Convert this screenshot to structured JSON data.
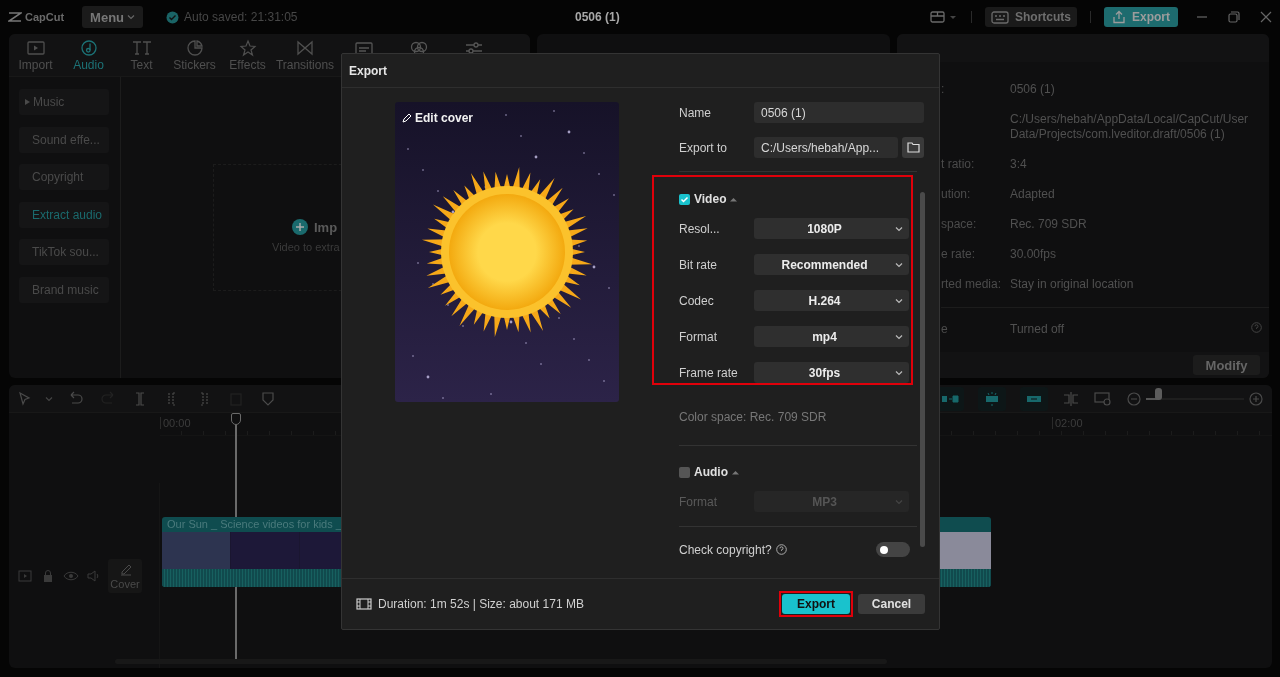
{
  "topbar": {
    "logo": "CapCut",
    "menu": "Menu",
    "autosave": "Auto saved: 21:31:05",
    "project_title": "0506 (1)",
    "shortcuts": "Shortcuts",
    "export": "Export"
  },
  "media_tabs": [
    {
      "label": "Import",
      "selected": false
    },
    {
      "label": "Audio",
      "selected": true
    },
    {
      "label": "Text",
      "selected": false
    },
    {
      "label": "Stickers",
      "selected": false
    },
    {
      "label": "Effects",
      "selected": false
    },
    {
      "label": "Transitions",
      "selected": false
    }
  ],
  "sidebar": {
    "items": [
      {
        "label": "Music",
        "kind": "group",
        "selected": false
      },
      {
        "label": "Sound effe...",
        "kind": "item",
        "selected": false
      },
      {
        "label": "Copyright",
        "kind": "item",
        "selected": false
      },
      {
        "label": "Extract audio",
        "kind": "item",
        "selected": true
      },
      {
        "label": "TikTok sou...",
        "kind": "item",
        "selected": false
      },
      {
        "label": "Brand music",
        "kind": "item",
        "selected": false
      }
    ]
  },
  "import_area": {
    "label": "Imp",
    "hint": "Video to extra"
  },
  "details": {
    "rows": [
      {
        "label": ":",
        "value": "0506 (1)",
        "kind": "text"
      },
      {
        "value": "C:/Users/hebah/AppData/Local/CapCut/User Data/Projects/com.lveditor.draft/0506 (1)",
        "kind": "text"
      },
      {
        "label": "t ratio:",
        "value": "3:4",
        "kind": "text"
      },
      {
        "label": "ution:",
        "value": "Adapted",
        "kind": "text"
      },
      {
        "label": "space:",
        "value": "Rec. 709 SDR",
        "kind": "text"
      },
      {
        "label": "e rate:",
        "value": "30.00fps",
        "kind": "text"
      },
      {
        "label": "rted media:",
        "value": "Stay in original location",
        "kind": "text"
      },
      {
        "label": "e",
        "value": "Turned off",
        "kind": "help"
      }
    ],
    "modify": "Modify"
  },
  "timeline": {
    "zoom": {
      "level": 0.12
    },
    "ruler": [
      "00:00",
      "02:00"
    ],
    "cover": "Cover",
    "clip_title": "Our Sun _ Science videos for kids _"
  },
  "export_dialog": {
    "title": "Export",
    "edit_cover": "Edit cover",
    "name": {
      "label": "Name",
      "value": "0506 (1)"
    },
    "export_to": {
      "label": "Export to",
      "value": "C:/Users/hebah/App..."
    },
    "video": {
      "label": "Video",
      "checked": true,
      "settings": [
        {
          "label": "Resol...",
          "value": "1080P",
          "disabled": false
        },
        {
          "label": "Bit rate",
          "value": "Recommended",
          "disabled": false
        },
        {
          "label": "Codec",
          "value": "H.264",
          "disabled": false
        },
        {
          "label": "Format",
          "value": "mp4",
          "disabled": false
        },
        {
          "label": "Frame rate",
          "value": "30fps",
          "disabled": false
        }
      ]
    },
    "color_space": "Color space: Rec. 709 SDR",
    "audio": {
      "label": "Audio",
      "checked": false,
      "settings": [
        {
          "label": "Format",
          "value": "MP3",
          "disabled": true
        }
      ]
    },
    "copyright": {
      "label": "Check copyright?",
      "on": false
    },
    "summary": "Duration: 1m 52s | Size: about 171 MB",
    "buttons": [
      {
        "label": "Export",
        "kind": "primary"
      },
      {
        "label": "Cancel",
        "kind": "secondary"
      }
    ]
  }
}
